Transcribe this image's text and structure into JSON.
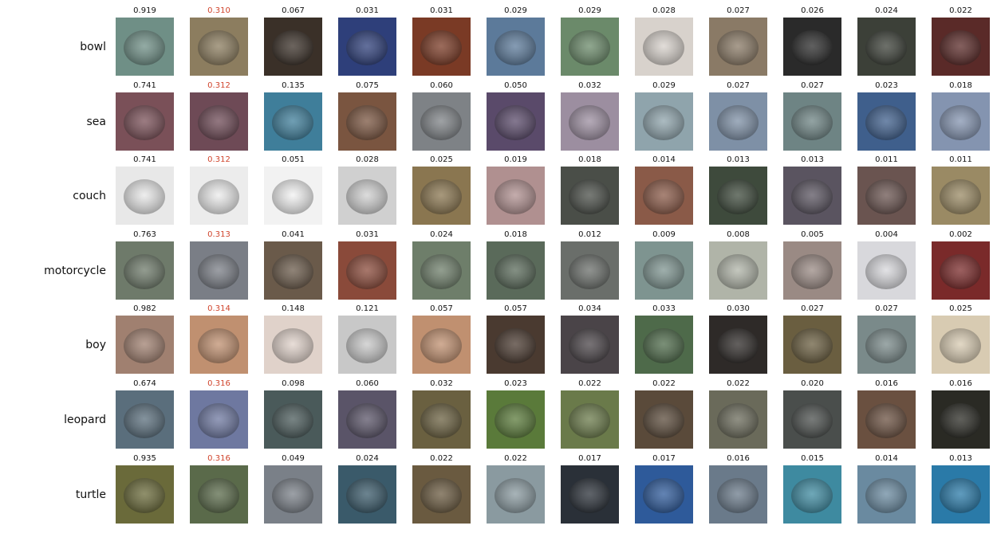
{
  "rows": [
    {
      "label": "bowl",
      "scores": [
        "0.919",
        "0.310",
        "0.067",
        "0.031",
        "0.031",
        "0.029",
        "0.029",
        "0.028",
        "0.027",
        "0.026",
        "0.024",
        "0.022"
      ]
    },
    {
      "label": "sea",
      "scores": [
        "0.741",
        "0.312",
        "0.135",
        "0.075",
        "0.060",
        "0.050",
        "0.032",
        "0.029",
        "0.027",
        "0.027",
        "0.023",
        "0.018"
      ]
    },
    {
      "label": "couch",
      "scores": [
        "0.741",
        "0.312",
        "0.051",
        "0.028",
        "0.025",
        "0.019",
        "0.018",
        "0.014",
        "0.013",
        "0.013",
        "0.011",
        "0.011"
      ]
    },
    {
      "label": "motorcycle",
      "scores": [
        "0.763",
        "0.313",
        "0.041",
        "0.031",
        "0.024",
        "0.018",
        "0.012",
        "0.009",
        "0.008",
        "0.005",
        "0.004",
        "0.002"
      ]
    },
    {
      "label": "boy",
      "scores": [
        "0.982",
        "0.314",
        "0.148",
        "0.121",
        "0.057",
        "0.057",
        "0.034",
        "0.033",
        "0.030",
        "0.027",
        "0.027",
        "0.025"
      ]
    },
    {
      "label": "leopard",
      "scores": [
        "0.674",
        "0.316",
        "0.098",
        "0.060",
        "0.032",
        "0.023",
        "0.022",
        "0.022",
        "0.022",
        "0.020",
        "0.016",
        "0.016"
      ]
    },
    {
      "label": "turtle",
      "scores": [
        "0.935",
        "0.316",
        "0.049",
        "0.024",
        "0.022",
        "0.022",
        "0.017",
        "0.017",
        "0.016",
        "0.015",
        "0.014",
        "0.013"
      ]
    }
  ],
  "highlight_column": 1,
  "highlight_color": "#d0442c",
  "thumb_colors": [
    [
      "#6f8f86",
      "#8c7d5f",
      "#3a3028",
      "#2e3f7a",
      "#7a3a25",
      "#5c7a9a",
      "#6b8a6a",
      "#d8d2cc",
      "#8a7a66",
      "#2a2a2a",
      "#3c4038",
      "#5a2a28"
    ],
    [
      "#7a5058",
      "#6e4a56",
      "#3f7e9a",
      "#7a5540",
      "#7e8286",
      "#5a4a6a",
      "#9c8ea0",
      "#8fa4ac",
      "#7e90a6",
      "#6e8484",
      "#3f5f8c",
      "#8494b0"
    ],
    [
      "#e8e8e8",
      "#ececec",
      "#f2f2f2",
      "#d0d0d0",
      "#8a7650",
      "#b09090",
      "#4a4e48",
      "#8a5a48",
      "#3e4a3c",
      "#5a5460",
      "#6a5450",
      "#9a8a64"
    ],
    [
      "#6e7a6a",
      "#7a7e86",
      "#6a5a4a",
      "#8a4a3a",
      "#6e7e6a",
      "#5a6a5a",
      "#6a6e6a",
      "#7e9490",
      "#b0b4a8",
      "#9a8a84",
      "#d8d8dc",
      "#7a2a2a"
    ],
    [
      "#a08070",
      "#c09070",
      "#e0d2ca",
      "#c8c8c8",
      "#c09070",
      "#4a3a30",
      "#4a4448",
      "#4e6a4a",
      "#2e2a28",
      "#6a5e40",
      "#7a8a8a",
      "#d8cbb2"
    ],
    [
      "#5a6e7c",
      "#6e78a0",
      "#4a5a5a",
      "#5a5468",
      "#6a6040",
      "#5a7a3a",
      "#6a7a4a",
      "#5a4a3a",
      "#6a6a5a",
      "#4a4e4c",
      "#6a5040",
      "#2a2a24"
    ],
    [
      "#6a6a3a",
      "#5a6a4a",
      "#7a8088",
      "#3a5a6a",
      "#6a5a40",
      "#8a9aa0",
      "#2a3038",
      "#2e5a9a",
      "#6a7a8a",
      "#3e8aa0",
      "#6a8aa0",
      "#2a7aa8"
    ]
  ]
}
